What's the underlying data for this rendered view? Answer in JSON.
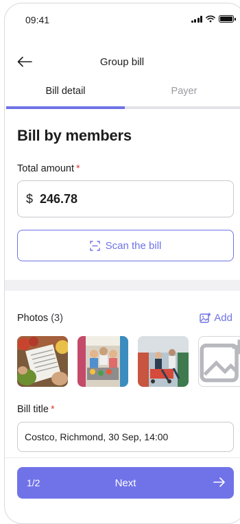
{
  "status_bar": {
    "time": "09:41"
  },
  "header": {
    "title": "Group bill"
  },
  "tabs": [
    {
      "label": "Bill detail",
      "active": true
    },
    {
      "label": "Payer",
      "active": false
    }
  ],
  "section_title": "Bill by members",
  "total_amount": {
    "label": "Total amount",
    "required_mark": "*",
    "currency": "$",
    "value": "246.78"
  },
  "scan_button": {
    "label": "Scan the bill",
    "icon": "scan-icon"
  },
  "photos": {
    "label": "Photos",
    "count": "(3)",
    "add_label": "Add",
    "items": [
      "receipt-photo",
      "shopping-cart-photo",
      "supermarket-photo"
    ]
  },
  "bill_title": {
    "label": "Bill title",
    "required_mark": "*",
    "value": "Costco, Richmond, 30 Sep, 14:00"
  },
  "footer": {
    "step": "1/2",
    "next_label": "Next"
  },
  "colors": {
    "accent": "#6f72e6",
    "required": "#e0413a",
    "button_bg": "#7073e8"
  }
}
